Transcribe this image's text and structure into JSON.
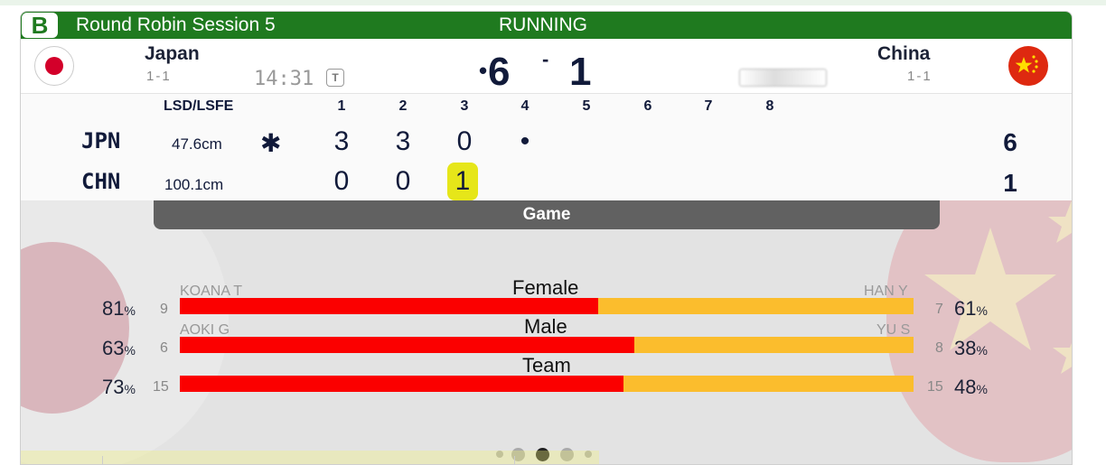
{
  "header": {
    "sheet": "B",
    "title": "Round Robin Session 5",
    "status": "RUNNING"
  },
  "teams": {
    "home": {
      "name": "Japan",
      "record": "1-1",
      "code": "JPN",
      "lsd": "47.6cm",
      "total": "6",
      "ends": [
        "3",
        "3",
        "0",
        "•"
      ],
      "flag": "japan-flag-icon"
    },
    "away": {
      "name": "China",
      "record": "1-1",
      "code": "CHN",
      "lsd": "100.1cm",
      "total": "1",
      "ends": [
        "0",
        "0",
        "1",
        ""
      ],
      "flag": "china-flag-icon"
    }
  },
  "clock": {
    "time": "14:31",
    "timeout_label": "T"
  },
  "score": {
    "hammer": "•",
    "home": "6",
    "separator": "-",
    "away": "1"
  },
  "grid": {
    "lsd_label": "LSD/LSFE",
    "ends": [
      "1",
      "2",
      "3",
      "4",
      "5",
      "6",
      "7",
      "8"
    ],
    "hammer_mark": "✱"
  },
  "game_label": "Game",
  "stats": [
    {
      "label": "Female",
      "home_player": "KOANA T",
      "away_player": "HAN Y",
      "home_count": "9",
      "away_count": "7",
      "home_pct": "81",
      "away_pct": "61",
      "home_share": 0.57
    },
    {
      "label": "Male",
      "home_player": "AOKI G",
      "away_player": "YU S",
      "home_count": "6",
      "away_count": "8",
      "home_pct": "63",
      "away_pct": "38",
      "home_share": 0.62
    },
    {
      "label": "Team",
      "home_player": "",
      "away_player": "",
      "home_count": "15",
      "away_count": "15",
      "home_pct": "73",
      "away_pct": "48",
      "home_share": 0.605
    }
  ],
  "pct_unit": "%",
  "pager": {
    "count": 5,
    "active": 2
  },
  "colors": {
    "header": "#1f7a1f",
    "home_bar": "#fb0000",
    "away_bar": "#fbbd2d",
    "highlight": "#e6e619"
  }
}
